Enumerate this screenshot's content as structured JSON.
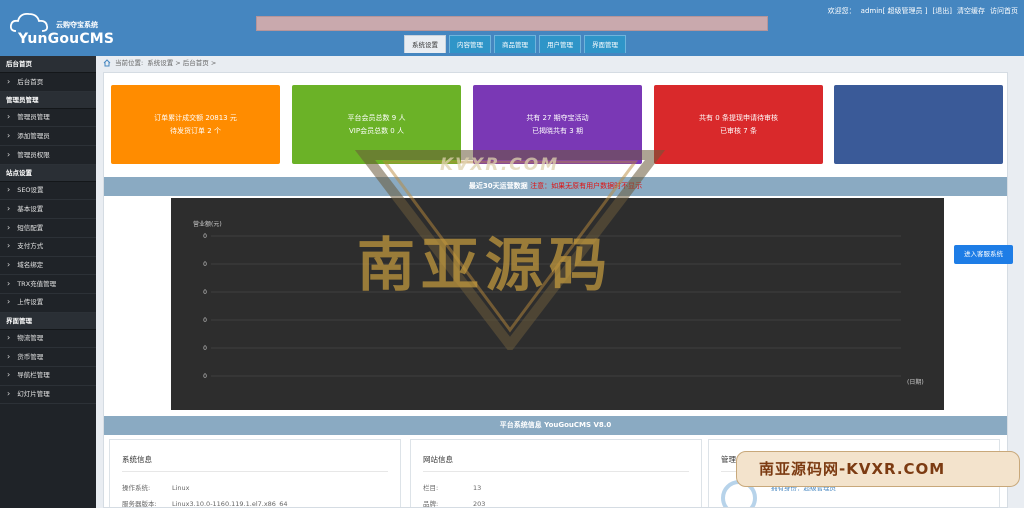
{
  "header": {
    "logo_sub": "云购夺宝系统",
    "logo_name": "YunGouCMS",
    "welcome": "欢迎您：",
    "user": "admin[ 超级管理员 ]",
    "logout": "[退出]",
    "clear_cache": "清空缓存",
    "visit_home": "访问首页"
  },
  "tabs": [
    "系统设置",
    "内容管理",
    "商品管理",
    "用户管理",
    "界面管理"
  ],
  "sidebar": {
    "groups": [
      {
        "title": "后台首页",
        "items": [
          "后台首页"
        ]
      },
      {
        "title": "管理员管理",
        "items": [
          "管理员管理",
          "添加管理员",
          "管理员权限"
        ]
      },
      {
        "title": "站点设置",
        "items": [
          "SEO设置",
          "基本设置",
          "短信配置",
          "支付方式",
          "域名绑定",
          "TRX充值管理",
          "上传设置"
        ]
      },
      {
        "title": "界面管理",
        "items": [
          "物流管理",
          "货币管理",
          "导航栏管理",
          "幻灯片管理"
        ]
      }
    ]
  },
  "breadcrumb": {
    "label": "当前位置:",
    "path": "系统设置 > 后台首页 >"
  },
  "stats": [
    {
      "line1": "订单累计成交额 20813 元",
      "line2": "待发货订单 2 个",
      "color": "#ff8c00"
    },
    {
      "line1": "平台会员总数 9 人",
      "line2": "VIP会员总数 0 人",
      "color": "#6bb227"
    },
    {
      "line1": "共有 27 期夺宝活动",
      "line2": "已揭晓共有 3 期",
      "color": "#7a38b5"
    },
    {
      "line1": "共有 0 条提现申请待审核",
      "line2": "已审核 7 条",
      "color": "#d9292b"
    },
    {
      "line1": "",
      "line2": "",
      "color": "#3a5a98"
    }
  ],
  "chart_section": {
    "title": "最近30天运营数据",
    "notice": "注意：如果无原有用户数据时不显示"
  },
  "chart_data": {
    "type": "line",
    "ylabel": "营业额(元)",
    "xlabel": "(日期)",
    "yticks": [
      "0",
      "0",
      "0",
      "0",
      "0",
      "0"
    ],
    "series": []
  },
  "service_button": "进入客服系统",
  "info_bar": "平台系统信息 YouGouCMS V8.0",
  "panels": [
    {
      "title": "系统信息",
      "rows": [
        [
          "操作系统:",
          "Linux"
        ],
        [
          "服务器版本:",
          "Linux3.10.0-1160.119.1.el7.x86_64"
        ]
      ]
    },
    {
      "title": "网站信息",
      "rows": [
        [
          "栏目:",
          "13"
        ],
        [
          "品牌:",
          "203"
        ]
      ]
    },
    {
      "title": "管理员信息",
      "rows": [
        [
          "",
          "拥有身份：超级管理员"
        ]
      ]
    }
  ],
  "watermark": {
    "main": "南亚源码",
    "sub": "KVXR.COM",
    "badge": "南亚源码网-KVXR.COM"
  }
}
